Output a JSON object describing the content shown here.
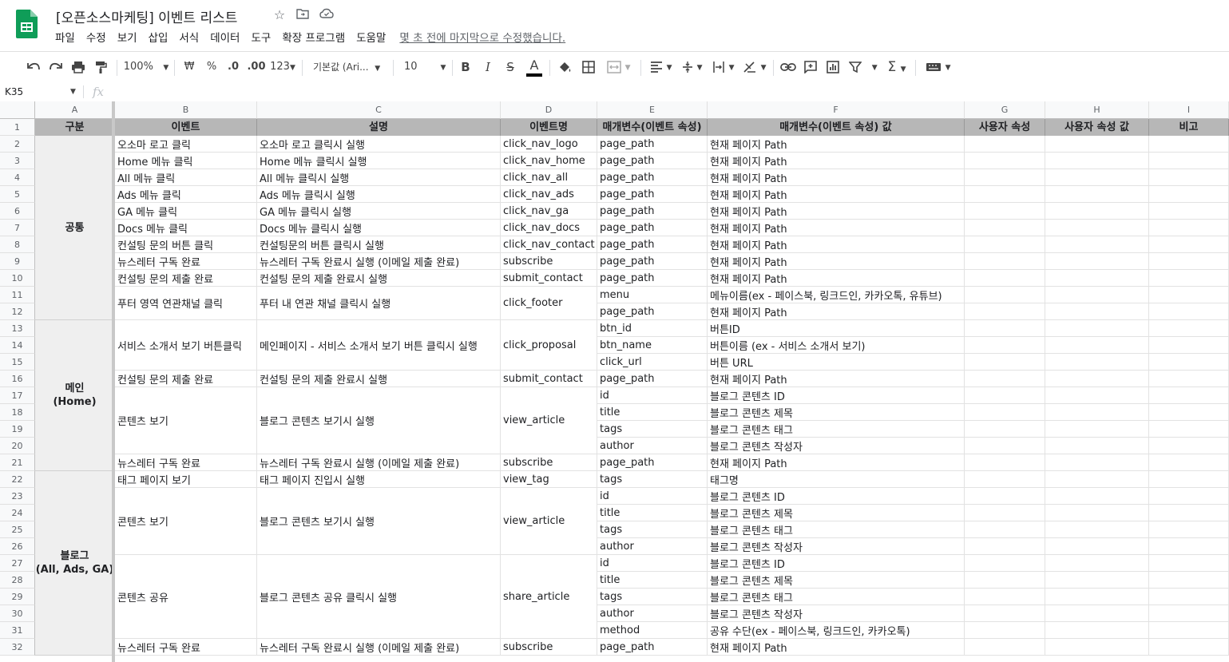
{
  "header": {
    "doc_title": "[오픈소스마케팅] 이벤트 리스트",
    "menu": [
      "파일",
      "수정",
      "보기",
      "삽입",
      "서식",
      "데이터",
      "도구",
      "확장 프로그램",
      "도움말"
    ],
    "last_edit": "몇 초 전에 마지막으로 수정했습니다."
  },
  "toolbar": {
    "zoom": "100%",
    "currency": "₩",
    "percent": "%",
    "dec_less": ".0",
    "dec_more": ".00",
    "format_more": "123",
    "font": "기본값 (Ari...",
    "font_size": "10",
    "bold": "B",
    "italic": "I",
    "strike": "S",
    "text_color_letter": "A"
  },
  "formula_bar": {
    "name_box": "K35",
    "fx": "fx",
    "value": ""
  },
  "columns": [
    "A",
    "B",
    "C",
    "D",
    "E",
    "F",
    "G",
    "H",
    "I"
  ],
  "header_row": [
    "구분",
    "이벤트",
    "설명",
    "이벤트명",
    "매개변수(이벤트 속성)",
    "매개변수(이벤트 속성) 값",
    "사용자 속성",
    "사용자 속성 값",
    "비고"
  ],
  "row_numbers": [
    "1",
    "2",
    "3",
    "4",
    "5",
    "6",
    "7",
    "8",
    "9",
    "10",
    "11",
    "12",
    "13",
    "14",
    "15",
    "16",
    "17",
    "18",
    "19",
    "20",
    "21",
    "22",
    "23",
    "24",
    "25",
    "26",
    "27",
    "28",
    "29",
    "30",
    "31",
    "32"
  ],
  "groups": [
    {
      "label": "공통"
    },
    {
      "label": "메인\n(Home)"
    },
    {
      "label": "블로그\n(All, Ads, GA)"
    }
  ],
  "merged_cells": [
    {
      "event": "오소마 로고 클릭",
      "desc": "오소마 로고 클릭시 실행",
      "name": "click_nav_logo"
    },
    {
      "event": "Home 메뉴 클릭",
      "desc": "Home 메뉴 클릭시 실행",
      "name": "click_nav_home"
    },
    {
      "event": "All 메뉴 클릭",
      "desc": "All 메뉴 클릭시 실행",
      "name": "click_nav_all"
    },
    {
      "event": "Ads 메뉴 클릭",
      "desc": "Ads 메뉴 클릭시 실행",
      "name": "click_nav_ads"
    },
    {
      "event": "GA 메뉴 클릭",
      "desc": "GA 메뉴 클릭시 실행",
      "name": "click_nav_ga"
    },
    {
      "event": "Docs 메뉴 클릭",
      "desc": "Docs 메뉴 클릭시 실행",
      "name": "click_nav_docs"
    },
    {
      "event": "컨설팅 문의 버튼 클릭",
      "desc": "컨설팅문의 버튼 클릭시 실행",
      "name": "click_nav_contact"
    },
    {
      "event": "뉴스레터 구독 완료",
      "desc": "뉴스레터 구독 완료시 실행 (이메일 제출 완료)",
      "name": "subscribe"
    },
    {
      "event": "컨설팅 문의 제출 완료",
      "desc": "컨설팅 문의 제출 완료시 실행",
      "name": "submit_contact"
    },
    {
      "event": "푸터 영역 연관채널 클릭",
      "desc": "푸터 내 연관 채널 클릭시 실행",
      "name": "click_footer"
    },
    {
      "event": "서비스 소개서 보기 버튼클릭",
      "desc": "메인페이지 - 서비스 소개서 보기 버튼 클릭시 실행",
      "name": "click_proposal"
    },
    {
      "event": "컨설팅 문의 제출 완료",
      "desc": "컨설팅 문의 제출 완료시 실행",
      "name": "submit_contact"
    },
    {
      "event": "콘텐츠 보기",
      "desc": "블로그 콘텐츠 보기시 실행",
      "name": "view_article"
    },
    {
      "event": "뉴스레터 구독 완료",
      "desc": "뉴스레터 구독 완료시 실행 (이메일 제출 완료)",
      "name": "subscribe"
    },
    {
      "event": "태그 페이지 보기",
      "desc": "태그 페이지 진입시 실행",
      "name": "view_tag"
    },
    {
      "event": "콘텐츠 보기",
      "desc": "블로그 콘텐츠 보기시 실행",
      "name": "view_article"
    },
    {
      "event": "콘텐츠 공유",
      "desc": "블로그 콘텐츠 공유 클릭시 실행",
      "name": "share_article"
    },
    {
      "event": "뉴스레터 구독 완료",
      "desc": "뉴스레터 구독 완료시 실행 (이메일 제출 완료)",
      "name": "subscribe"
    }
  ],
  "param_rows": [
    {
      "param": "page_path",
      "value": "현재 페이지 Path"
    },
    {
      "param": "page_path",
      "value": "현재 페이지 Path"
    },
    {
      "param": "page_path",
      "value": "현재 페이지 Path"
    },
    {
      "param": "page_path",
      "value": "현재 페이지 Path"
    },
    {
      "param": "page_path",
      "value": "현재 페이지 Path"
    },
    {
      "param": "page_path",
      "value": "현재 페이지 Path"
    },
    {
      "param": "page_path",
      "value": "현재 페이지 Path"
    },
    {
      "param": "page_path",
      "value": "현재 페이지 Path"
    },
    {
      "param": "page_path",
      "value": "현재 페이지 Path"
    },
    {
      "param": "menu",
      "value": "메뉴이름(ex - 페이스북, 링크드인, 카카오톡, 유튜브)"
    },
    {
      "param": "page_path",
      "value": "현재 페이지 Path"
    },
    {
      "param": "btn_id",
      "value": "버튼ID"
    },
    {
      "param": "btn_name",
      "value": "버튼이름 (ex - 서비스 소개서 보기)"
    },
    {
      "param": "click_url",
      "value": "버튼 URL"
    },
    {
      "param": "page_path",
      "value": "현재 페이지 Path"
    },
    {
      "param": "id",
      "value": "블로그 콘텐츠 ID"
    },
    {
      "param": "title",
      "value": "블로그 콘텐츠 제목"
    },
    {
      "param": "tags",
      "value": "블로그 콘텐츠 태그"
    },
    {
      "param": "author",
      "value": "블로그 콘텐츠 작성자"
    },
    {
      "param": "page_path",
      "value": "현재 페이지 Path"
    },
    {
      "param": "tags",
      "value": "태그명"
    },
    {
      "param": "id",
      "value": "블로그 콘텐츠 ID"
    },
    {
      "param": "title",
      "value": "블로그 콘텐츠 제목"
    },
    {
      "param": "tags",
      "value": "블로그 콘텐츠 태그"
    },
    {
      "param": "author",
      "value": "블로그 콘텐츠 작성자"
    },
    {
      "param": "id",
      "value": "블로그 콘텐츠 ID"
    },
    {
      "param": "title",
      "value": "블로그 콘텐츠 제목"
    },
    {
      "param": "tags",
      "value": "블로그 콘텐츠 태그"
    },
    {
      "param": "author",
      "value": "블로그 콘텐츠 작성자"
    },
    {
      "param": "method",
      "value": "공유 수단(ex - 페이스북, 링크드인, 카카오톡)"
    },
    {
      "param": "page_path",
      "value": "현재 페이지 Path"
    }
  ],
  "colors": {
    "header_fill": "#b7b7b7",
    "group_fill": "#efefef",
    "brand_green": "#0f9d58"
  }
}
